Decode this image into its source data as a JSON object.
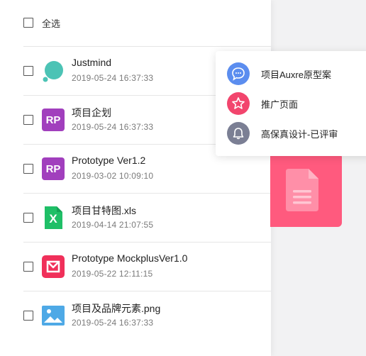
{
  "file_list": {
    "select_all_label": "全选",
    "items": [
      {
        "name": "Justmind",
        "date": "2019-05-24 16:37:33",
        "icon": "justmind-icon",
        "checked": false
      },
      {
        "name": "项目企划",
        "date": "2019-05-24 16:37:33",
        "icon": "rp-icon",
        "icon_text": "RP",
        "checked": false
      },
      {
        "name": "Prototype Ver1.2",
        "date": "2019-03-02 10:09:10",
        "icon": "rp-icon",
        "icon_text": "RP",
        "checked": false
      },
      {
        "name": "项目甘特图.xls",
        "date": "2019-04-14 21:07:55",
        "icon": "excel-icon",
        "icon_text": "X",
        "checked": false
      },
      {
        "name": "Prototype MockplusVer1.0",
        "date": "2019-05-22 12:11:15",
        "icon": "mockplus-icon",
        "checked": false
      },
      {
        "name": "项目及品牌元素.png",
        "date": "2019-05-24 16:37:33",
        "icon": "image-icon",
        "checked": false
      }
    ]
  },
  "context_menu": {
    "items": [
      {
        "label": "项目Auxre原型案",
        "icon": "chat-bubble-icon",
        "color": "#5b8def"
      },
      {
        "label": "推广页面",
        "icon": "star-icon",
        "color": "#f2456d"
      },
      {
        "label": "高保真设计-已评审",
        "icon": "bell-icon",
        "color": "#7b7f94"
      }
    ]
  },
  "colors": {
    "rp_purple": "#a13fbd",
    "excel_green": "#1fbf67",
    "mockplus_red": "#f0305a",
    "justmind_teal": "#4cc3b5",
    "image_blue": "#4ea9e6",
    "pink_card": "#ff5a7e"
  }
}
